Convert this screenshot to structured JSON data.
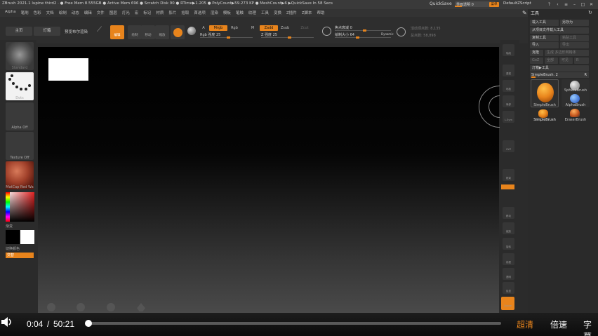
{
  "title_bar": {
    "app_info": "ZBrush 2021.1  lupine third2 · ● Free Mem 8.555GB ● Active Mem 696 ● Scratch Disk 90 ● RTime▶1.205 ● PolyCount▶59.273 KP ● MeshCount▶6 ▶QuickSave In 58 Secs",
    "quicksave": "QuickSave",
    "transparency_label": "界面透明 0",
    "menu_button": "菜单",
    "script_label": "DefaultZScript",
    "controls": [
      "?",
      "‹",
      "≡",
      "–",
      "□",
      "✕"
    ]
  },
  "menu_bar": {
    "items": [
      "Alpha",
      "笔刷",
      "色彩",
      "文档",
      "绘制",
      "动态",
      "编辑",
      "文件",
      "图层",
      "灯光",
      "宏",
      "标记",
      "材质",
      "影片",
      "拾取",
      "首选项",
      "渲染",
      "模板",
      "笔触",
      "纹理",
      "工具",
      "变换",
      "Z插件",
      "Z脚本",
      "帮助"
    ]
  },
  "toolbar": {
    "home": "主页",
    "lightbox": "灯箱",
    "preview_render": "预览布尔渲染",
    "icons": [
      {
        "icon": "edit-icon",
        "label": "编辑",
        "active": true
      },
      {
        "icon": "draw-icon",
        "label": "绘制",
        "active": false
      },
      {
        "icon": "move-icon",
        "label": "移动",
        "active": false
      },
      {
        "icon": "scale-icon",
        "label": "缩放",
        "active": false
      },
      {
        "icon": "rotate-icon",
        "label": "旋转",
        "active": false
      }
    ],
    "mode_a": "A",
    "mrgb": "Mrgb",
    "rgb": "Rgb",
    "m": "M",
    "zadd": "Zadd",
    "zsub": "Zsub",
    "zcut": "Zcut",
    "rgb_intensity": "Rgb 强度 25",
    "rgb_intensity_value": 25,
    "z_intensity": "Z 强度 25",
    "z_intensity_value": 25,
    "focal_shift": "焦点衰减 0",
    "draw_size": "绘制大小 64",
    "draw_size_value": 64,
    "dynamic": "Dynamic",
    "active_points": "活动顶点数: 8,135",
    "total_points": "总点数: 58,898"
  },
  "left_shelf": {
    "brush_label": "Standard",
    "stroke_label": "Dots",
    "alpha_label": "Alpha Off",
    "texture_label": "Texture Off",
    "material_label": "MatCap Red Wa",
    "gradient_label": "渐变",
    "switch_color_label": "切换颜色",
    "alternate_label": "交替"
  },
  "right_shelf": {
    "icons": [
      "轴线",
      "透视",
      "地板",
      "局部",
      "L.Sym",
      "XYZ",
      "框架",
      "移动",
      "缩放",
      "旋转",
      "线框",
      "透明",
      "独显",
      "Xpose"
    ]
  },
  "tool_panel": {
    "header": "工具",
    "buttons_row1": [
      "载入工具",
      "另存为"
    ],
    "load_from_project": "从项目文件载入工具",
    "buttons_row2": [
      "复制工具",
      "粘贴工具"
    ],
    "buttons_row3": [
      "导入",
      "导出"
    ],
    "buttons_row4": [
      "克隆",
      "生成 多边形网格体"
    ],
    "buttons_row5": [
      "GoZ",
      "全部",
      "可见",
      "R"
    ],
    "lightbox_tools": "灯箱▶工具",
    "current_tool": "SimpleBrush. 2",
    "current_tool_r": "R",
    "tools": [
      "SimpleBrush",
      "SphereBrush",
      "SimpleBrush",
      "AlphaBrush",
      "SimpleBrush",
      "EraserBrush"
    ]
  },
  "player": {
    "current_time": "0:04",
    "separator": "/",
    "total_time": "50:21",
    "progress_fraction": 0.0013,
    "quality": "超清",
    "speed": "倍速",
    "subtitles": "字幕"
  },
  "colors": {
    "accent": "#e8841c",
    "panel_bg": "#2b2b2b",
    "canvas_top": "#000000",
    "canvas_bottom": "#4a4a4a"
  }
}
